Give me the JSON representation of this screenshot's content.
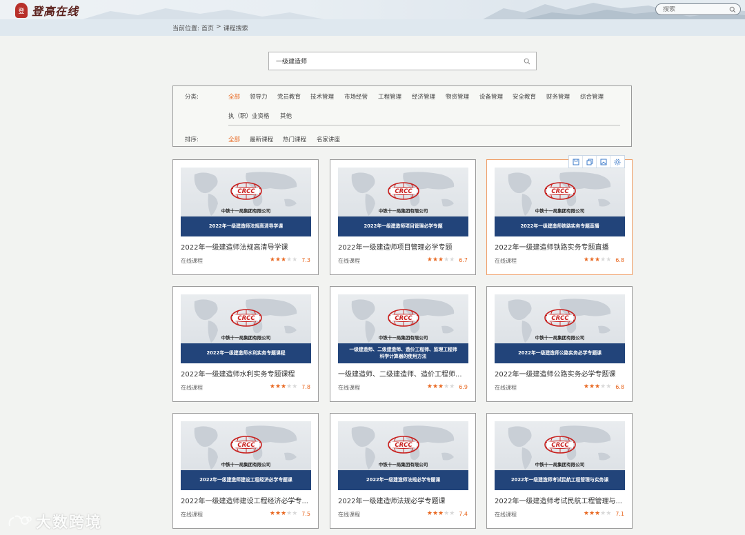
{
  "header": {
    "logo_seal": "登",
    "logo_text": "登高在线",
    "search_placeholder": "搜索"
  },
  "breadcrumb": {
    "prefix": "当前位置:",
    "home": "首页",
    "separator": ">",
    "current": "课程搜索"
  },
  "search": {
    "value": "一级建造师"
  },
  "filters": {
    "category_label": "分类:",
    "categories_row1": [
      "全部",
      "领导力",
      "党员教育",
      "技术管理",
      "市场经营",
      "工程管理",
      "经济管理",
      "物资管理",
      "设备管理",
      "安全教育",
      "财务管理",
      "综合管理"
    ],
    "categories_row2": [
      "执（职）业资格",
      "其他"
    ],
    "active_category": "全部",
    "sort_label": "排序:",
    "sorts": [
      "全部",
      "最新课程",
      "热门课程",
      "名家讲座"
    ],
    "active_sort": "全部"
  },
  "thumb_company": "中铁十一局集团有限公司",
  "cards": [
    {
      "banner": "2022年一级建造师法规高清导学课",
      "title": "2022年一级建造师法规高清导学课",
      "type": "在线课程",
      "stars": 3,
      "score": "7.3"
    },
    {
      "banner": "2022年一级建造师项目管理必学专题",
      "title": "2022年一级建造师项目管理必学专题",
      "type": "在线课程",
      "stars": 3,
      "score": "6.7"
    },
    {
      "banner": "2022年一级建造师铁路实务专题直播",
      "title": "2022年一级建造师铁路实务专题直播",
      "type": "在线课程",
      "stars": 3,
      "score": "6.8"
    },
    {
      "banner": "2022年一级建造师水利实务专题课程",
      "title": "2022年一级建造师水利实务专题课程",
      "type": "在线课程",
      "stars": 3,
      "score": "7.8"
    },
    {
      "banner": "一级建造师、二级建造师、造价工程师、监理工程师科学计算器的使用方法",
      "title": "一级建造师、二级建造师、造价工程师...",
      "type": "在线课程",
      "stars": 3,
      "score": "6.9"
    },
    {
      "banner": "2022年一级建造师公路实务必学专题课",
      "title": "2022年一级建造师公路实务必学专题课",
      "type": "在线课程",
      "stars": 3,
      "score": "6.8"
    },
    {
      "banner": "2022年一级建造师建设工程经济必学专题课",
      "title": "2022年一级建造师建设工程经济必学专...",
      "type": "在线课程",
      "stars": 3,
      "score": "7.5"
    },
    {
      "banner": "2022年一级建造师法规必学专题课",
      "title": "2022年一级建造师法规必学专题课",
      "type": "在线课程",
      "stars": 3,
      "score": "7.4"
    },
    {
      "banner": "2022年一级建造师考试民航工程管理与实务课",
      "title": "2022年一级建造师考试民航工程管理与...",
      "type": "在线课程",
      "stars": 3,
      "score": "7.1"
    }
  ],
  "toolbar_icons": [
    "save-icon",
    "copy-icon",
    "screenshot-icon",
    "settings-icon"
  ],
  "watermark": "大数跨境",
  "colors": {
    "accent": "#e8661e",
    "banner": "#22447a",
    "crcc_red": "#c8201e"
  }
}
